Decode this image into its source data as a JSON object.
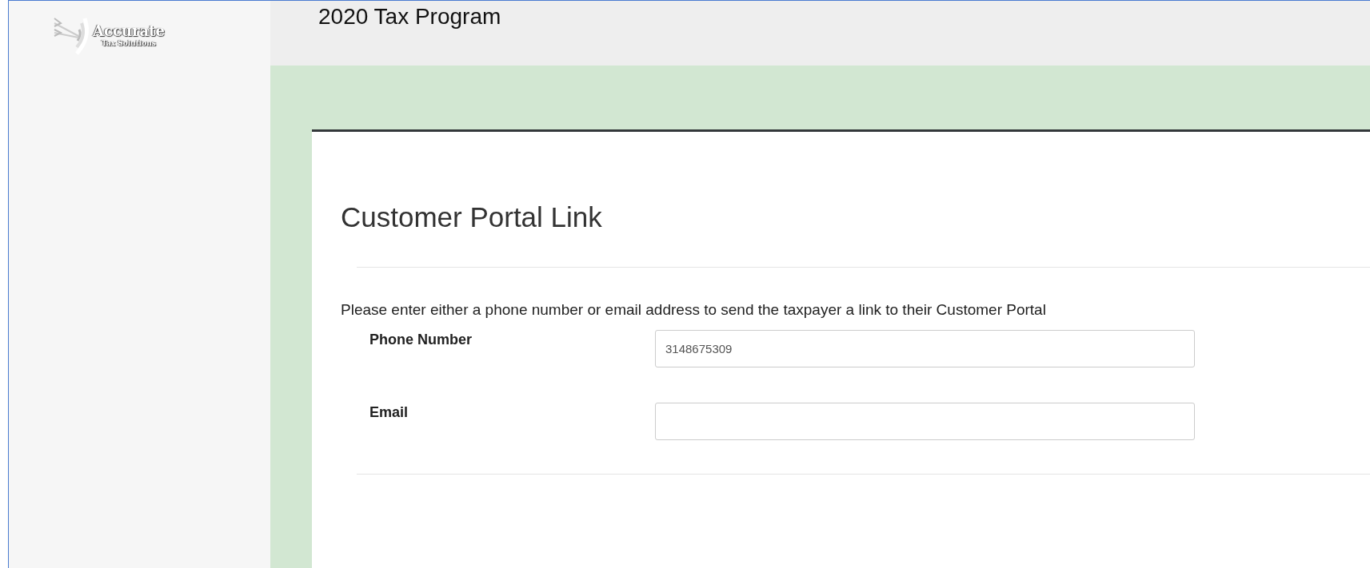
{
  "logo": {
    "name": "Accurate",
    "tagline": "Tax Solutions"
  },
  "header": {
    "title": "2020 Tax Program"
  },
  "card": {
    "title": "Customer Portal Link",
    "instruction": "Please enter either a phone number or email address to send the taxpayer a link to their Customer Portal",
    "fields": [
      {
        "label": "Phone Number",
        "value": "3148675309"
      },
      {
        "label": "Email"
      }
    ]
  }
}
